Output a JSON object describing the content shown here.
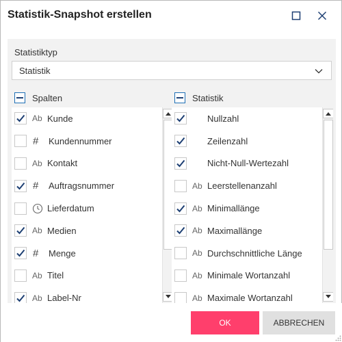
{
  "dialog": {
    "title": "Statistik-Snapshot erstellen"
  },
  "statistic_type": {
    "label": "Statistiktyp",
    "selected": "Statistik"
  },
  "columns_panel": {
    "header": "Spalten",
    "items": [
      {
        "type": "Ab",
        "label": "Kunde",
        "checked": true
      },
      {
        "type": "#",
        "label": "Kundennummer",
        "checked": false
      },
      {
        "type": "Ab",
        "label": "Kontakt",
        "checked": false
      },
      {
        "type": "#",
        "label": "Auftragsnummer",
        "checked": true
      },
      {
        "type": "clock",
        "label": "Lieferdatum",
        "checked": false
      },
      {
        "type": "Ab",
        "label": "Medien",
        "checked": true
      },
      {
        "type": "#",
        "label": "Menge",
        "checked": true
      },
      {
        "type": "Ab",
        "label": "Titel",
        "checked": false
      },
      {
        "type": "Ab",
        "label": "Label-Nr",
        "checked": true
      }
    ]
  },
  "statistics_panel": {
    "header": "Statistik",
    "items": [
      {
        "type": "",
        "label": "Nullzahl",
        "checked": true
      },
      {
        "type": "",
        "label": "Zeilenzahl",
        "checked": true
      },
      {
        "type": "",
        "label": "Nicht-Null-Wertezahl",
        "checked": true
      },
      {
        "type": "Ab",
        "label": "Leerstellenanzahl",
        "checked": false
      },
      {
        "type": "Ab",
        "label": "Minimallänge",
        "checked": true
      },
      {
        "type": "Ab",
        "label": "Maximallänge",
        "checked": true
      },
      {
        "type": "Ab",
        "label": "Durchschnittliche Länge",
        "checked": false
      },
      {
        "type": "Ab",
        "label": "Minimale Wortanzahl",
        "checked": false
      },
      {
        "type": "Ab",
        "label": "Maximale Wortanzahl",
        "checked": false
      }
    ]
  },
  "footer": {
    "ok_label": "OK",
    "cancel_label": "ABBRECHEN"
  },
  "colors": {
    "accent": "#ff3f6c",
    "check": "#1d3f73",
    "header_bg": "#f2f2f2"
  }
}
